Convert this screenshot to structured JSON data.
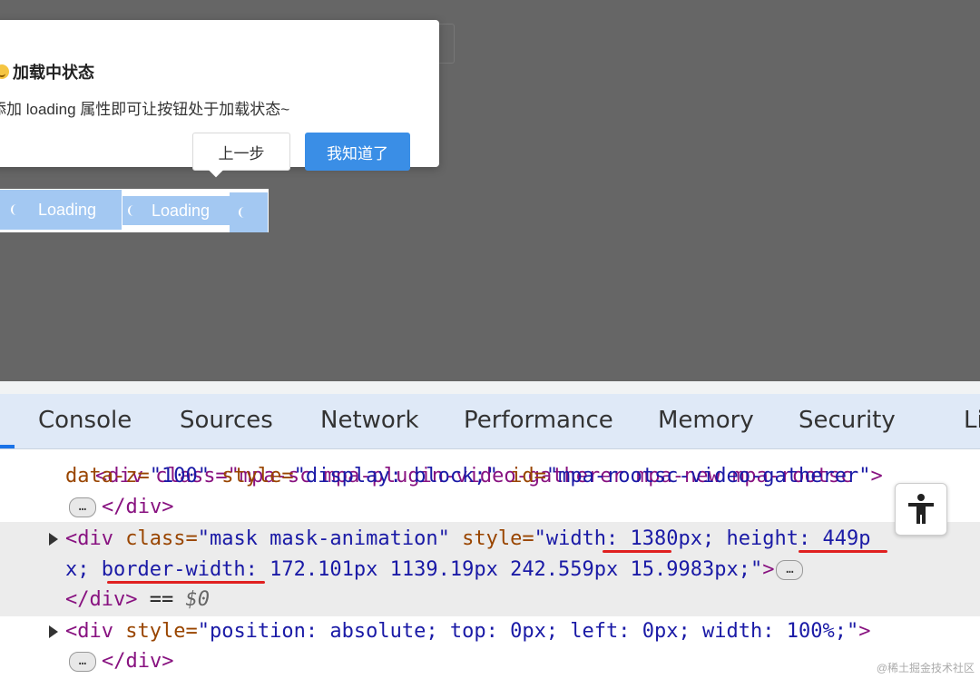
{
  "popover": {
    "title": "加载中状态",
    "description": "添加 loading 属性即可让按钮处于加载状态~",
    "prev_label": "上一步",
    "ok_label": "我知道了"
  },
  "loading_buttons": [
    {
      "label": "Loading"
    },
    {
      "label": "Loading"
    },
    {
      "label": ""
    }
  ],
  "devtools": {
    "tabs": [
      "Console",
      "Sources",
      "Network",
      "Performance",
      "Memory",
      "Security",
      "Li"
    ]
  },
  "code": {
    "line0": "<div class=\"mpa-sc mpa-plugin-video-gatherer mpa-new mpa-rootsc",
    "line1_a": "data-z=",
    "line1_b": "\"100\"",
    "line1_c": " style=",
    "line1_d": "\"display: block;\"",
    "line1_e": " id=",
    "line1_f": "\"mpa-rootsc-video-gatherer\"",
    "line1_g": ">",
    "line2": "</div>",
    "line3_a": "<div",
    "line3_b": " class=",
    "line3_c": "\"mask mask-animation\"",
    "line3_d": " style=",
    "line3_e": "\"width: 1380px; height: 449p",
    "line4_a": "x; border-width: 172.101px 1139.19px 242.559px 15.9983px;\"",
    "line4_b": ">",
    "line5_a": "</div>",
    "line5_b": " == ",
    "line5_c": "$0",
    "line6_a": "<div",
    "line6_b": " style=",
    "line6_c": "\"position: absolute; top: 0px; left: 0px; width: 100%;\"",
    "line6_d": ">",
    "line7": "</div>",
    "ellipsis": "…"
  },
  "watermark": "@稀土掘金技术社区"
}
